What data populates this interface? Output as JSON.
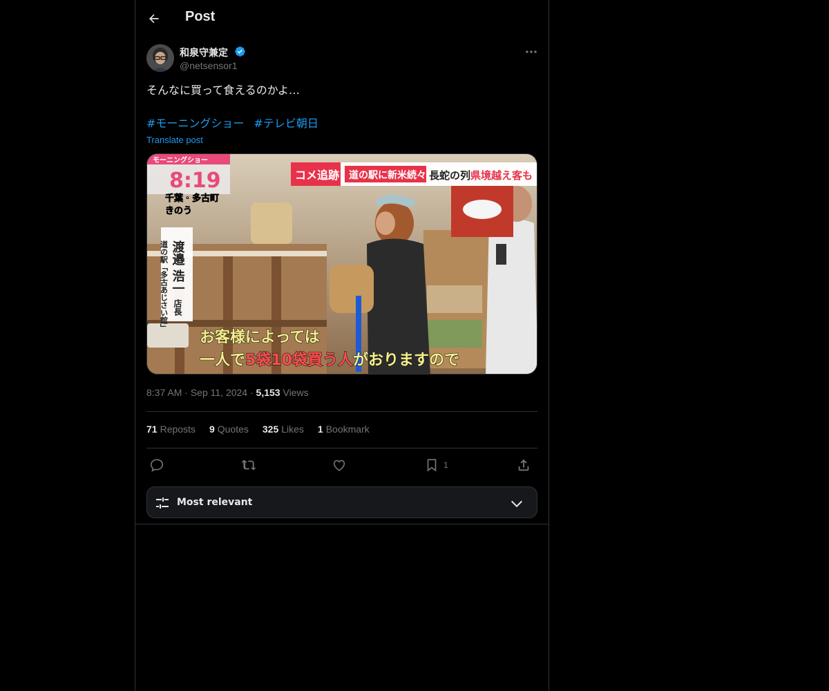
{
  "topbar": {
    "title": "Post",
    "back_icon": "arrow-left-icon"
  },
  "author": {
    "name": "和泉守兼定",
    "handle": "@netsensor1",
    "verified": true,
    "verified_color": "#1d9bf0"
  },
  "post": {
    "text": "そんなに買って食えるのかよ…",
    "hashtags": [
      "#モーニングショー",
      "#テレビ朝日"
    ],
    "translate_label": "Translate post",
    "media": {
      "program_label": "モーニングショー",
      "clock": "8:19",
      "headline_tag": "コメ追跡",
      "headline_main": "道の駅に新米続々",
      "headline_sub1": "長蛇の列",
      "headline_sub2": "県境越え客も",
      "location_line1": "千葉・多古町",
      "location_line2": "きのう",
      "speaker_org": "道の駅「多古あじさい館」",
      "speaker_name": "渡邉 浩一",
      "speaker_title": "店長",
      "subtitle_line1": "お客様によっては",
      "subtitle_line2_a": "一人で",
      "subtitle_line2_b": "5袋10袋",
      "subtitle_line2_c": "買う人",
      "subtitle_line2_d": "がおりますので"
    }
  },
  "meta": {
    "time": "8:37 AM",
    "date": "Sep 11, 2024",
    "views_count": "5,153",
    "views_label": "Views",
    "sep": "·"
  },
  "stats": {
    "reposts_count": "71",
    "reposts_label": "Reposts",
    "quotes_count": "9",
    "quotes_label": "Quotes",
    "likes_count": "325",
    "likes_label": "Likes",
    "bookmarks_count": "1",
    "bookmarks_label": "Bookmark"
  },
  "actions": {
    "bookmark_count": "1"
  },
  "sort": {
    "label": "Most relevant"
  },
  "colors": {
    "accent": "#1d9bf0",
    "background": "#000000",
    "muted": "#71767b",
    "border": "#2f3336"
  }
}
